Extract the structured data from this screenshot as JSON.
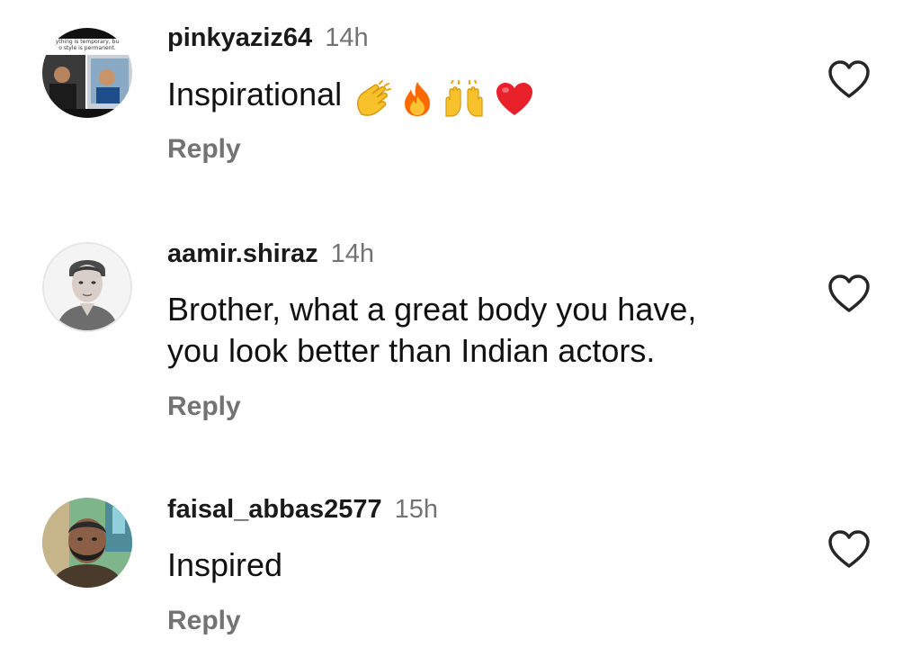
{
  "comments": [
    {
      "username": "pinkyaziz64",
      "time": "14h",
      "text_lines": [
        "Inspirational"
      ],
      "emojis": [
        "clapping-hands",
        "fire",
        "raising-hands",
        "red-heart"
      ],
      "reply_label": "Reply",
      "avatar_caption_lines": [
        "ything is temporary, bu",
        "o style is permanent."
      ]
    },
    {
      "username": "aamir.shiraz",
      "time": "14h",
      "text_lines": [
        "Brother, what a great body you have,",
        "you look better than Indian actors."
      ],
      "reply_label": "Reply"
    },
    {
      "username": "faisal_abbas2577",
      "time": "15h",
      "text_lines": [
        "Inspired"
      ],
      "reply_label": "Reply"
    }
  ],
  "colors": {
    "text": "#111111",
    "muted": "#737373",
    "heart_outline": "#262626",
    "emoji_heart": "#e8202a",
    "emoji_fire": "#ff6a00",
    "emoji_hands": "#f7c12b"
  }
}
